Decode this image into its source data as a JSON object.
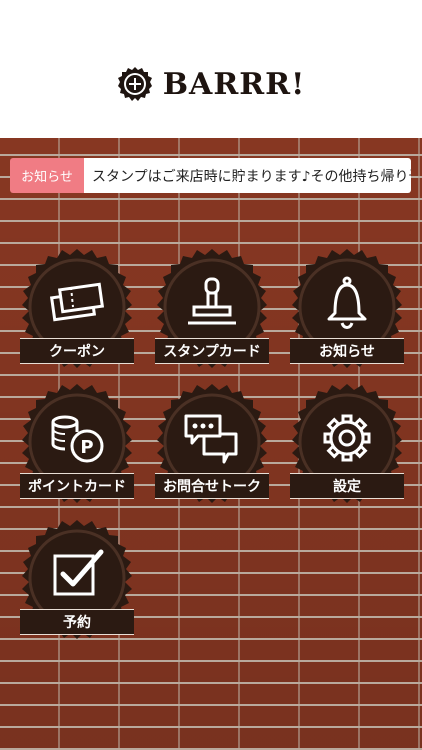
{
  "header": {
    "brand": "BARRR!",
    "logo_icon": "bottle-cap-logo-icon"
  },
  "notice": {
    "label": "お知らせ",
    "text": "スタンプはご来店時に貯まります♪その他持ち帰り予約"
  },
  "menu": [
    {
      "label": "クーポン",
      "icon": "ticket-icon"
    },
    {
      "label": "スタンプカード",
      "icon": "stamp-icon"
    },
    {
      "label": "お知らせ",
      "icon": "bell-icon"
    },
    {
      "label": "ポイントカード",
      "icon": "coins-icon"
    },
    {
      "label": "お問合せトーク",
      "icon": "chat-icon"
    },
    {
      "label": "設定",
      "icon": "gear-icon"
    },
    {
      "label": "予約",
      "icon": "checkbox-icon"
    }
  ],
  "colors": {
    "brick": "#8e3a24",
    "cap": "#2b1a12",
    "notice_label": "#f07c84"
  }
}
